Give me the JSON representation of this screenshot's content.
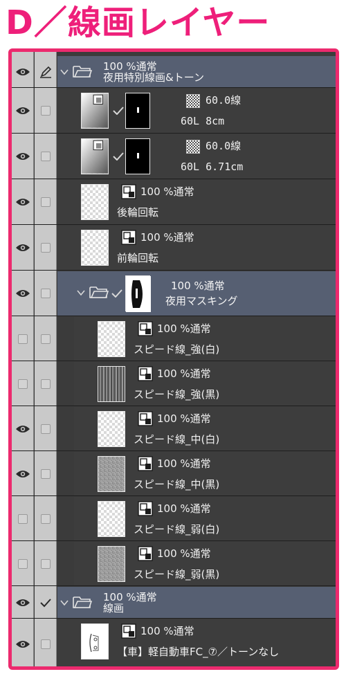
{
  "heading": "D／線画レイヤー",
  "colors": {
    "accent": "#ec2a6e",
    "heading": "#ee1f7a",
    "panel_bg": "#3b3b3b",
    "folder_bg": "#565f72",
    "column_bg": "#c9c9c9"
  },
  "layers": [
    {
      "id": "folder-night-special-lines",
      "kind": "folder",
      "visible": true,
      "top_mark": "pen-icon",
      "blend": "100 %通常",
      "name": "夜用特別線画&トーン",
      "expanded": true
    },
    {
      "id": "tone-60-8cm",
      "kind": "tone",
      "visible": true,
      "blend": "60.0線",
      "name": "60L 8cm",
      "thumb": "gradient",
      "mask": true
    },
    {
      "id": "tone-60-671cm",
      "kind": "tone",
      "visible": true,
      "blend": "60.0線",
      "name": "60L 6.71cm",
      "thumb": "gradient",
      "mask": true
    },
    {
      "id": "rear-wheel",
      "kind": "raster",
      "visible": true,
      "blend": "100 %通常",
      "name": "後輪回転",
      "thumb": "transparent"
    },
    {
      "id": "front-wheel",
      "kind": "raster",
      "visible": true,
      "blend": "100 %通常",
      "name": "前輪回転",
      "thumb": "transparent"
    },
    {
      "id": "folder-night-masking",
      "kind": "folder",
      "visible": true,
      "blend": "100 %通常",
      "name": "夜用マスキング",
      "expanded": true,
      "mask": true
    },
    {
      "id": "speed-strong-white",
      "kind": "raster",
      "visible": false,
      "blend": "100 %通常",
      "name": "スピード線_強(白)",
      "thumb": "transparent"
    },
    {
      "id": "speed-strong-black",
      "kind": "raster",
      "visible": false,
      "blend": "100 %通常",
      "name": "スピード線_強(黒)",
      "thumb": "dark"
    },
    {
      "id": "speed-mid-white",
      "kind": "raster",
      "visible": true,
      "blend": "100 %通常",
      "name": "スピード線_中(白)",
      "thumb": "transparent"
    },
    {
      "id": "speed-mid-black",
      "kind": "raster",
      "visible": true,
      "blend": "100 %通常",
      "name": "スピード線_中(黒)",
      "thumb": "grey"
    },
    {
      "id": "speed-weak-white",
      "kind": "raster",
      "visible": false,
      "blend": "100 %通常",
      "name": "スピード線_弱(白)",
      "thumb": "transparent"
    },
    {
      "id": "speed-weak-black",
      "kind": "raster",
      "visible": false,
      "blend": "100 %通常",
      "name": "スピード線_弱(黒)",
      "thumb": "grey"
    },
    {
      "id": "folder-lineart",
      "kind": "folder",
      "visible": true,
      "top_mark": "tick-icon",
      "blend": "100 %通常",
      "name": "線画",
      "expanded": true
    },
    {
      "id": "car-lineart",
      "kind": "raster",
      "visible": true,
      "blend": "100 %通常",
      "name": "【車】軽自動車FC_⑦／トーンなし",
      "thumb": "car"
    }
  ]
}
